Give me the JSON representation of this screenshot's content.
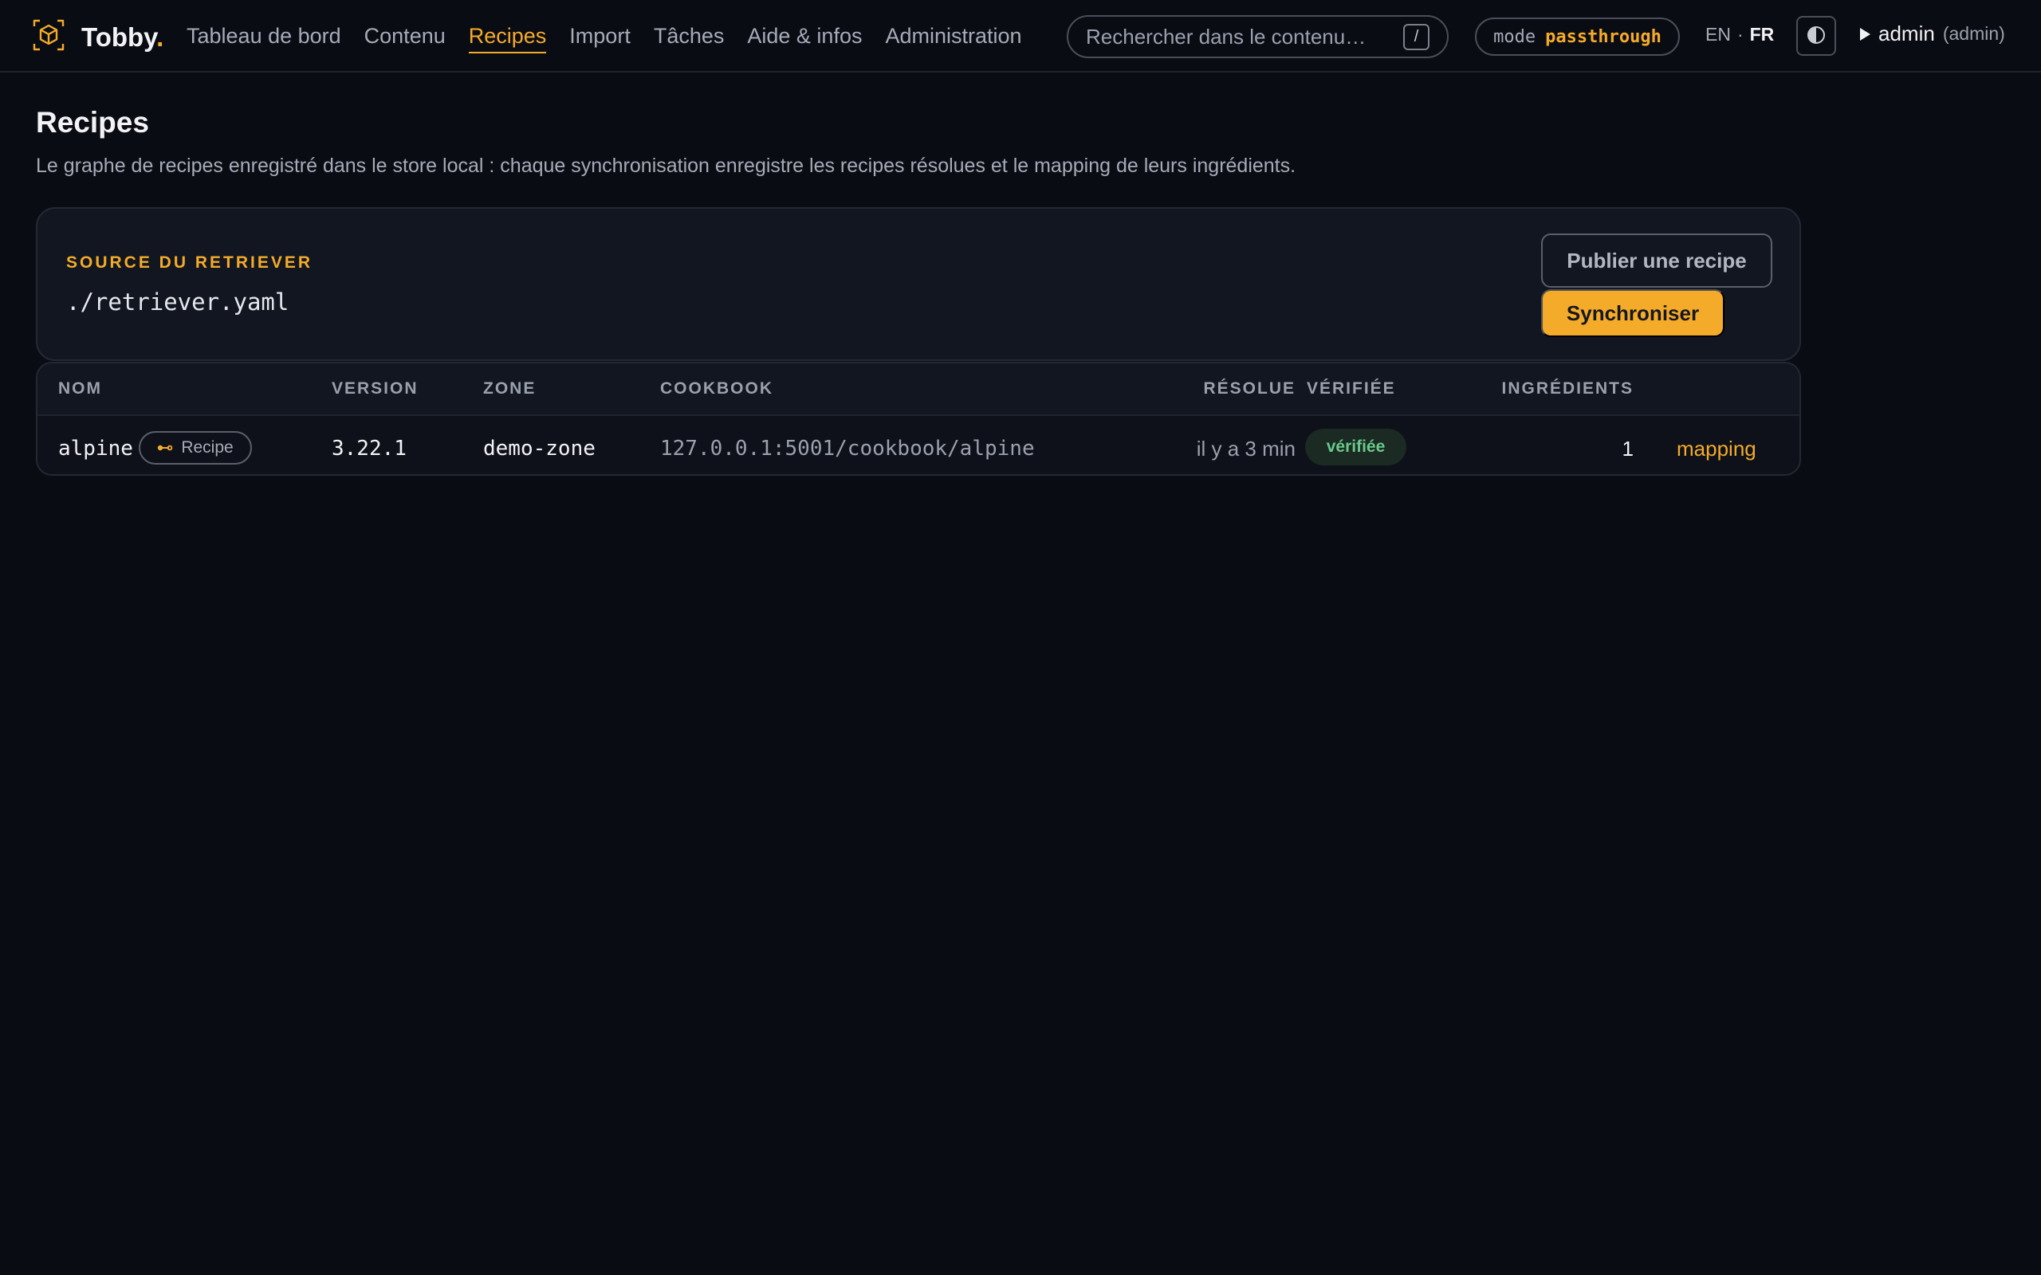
{
  "app": {
    "brand": "Tobby",
    "brand_dot": "."
  },
  "nav": {
    "items": [
      {
        "label": "Tableau de bord"
      },
      {
        "label": "Contenu"
      },
      {
        "label": "Recipes",
        "active": true
      },
      {
        "label": "Import"
      },
      {
        "label": "Tâches"
      },
      {
        "label": "Aide & infos"
      },
      {
        "label": "Administration"
      }
    ]
  },
  "search": {
    "placeholder": "Rechercher dans le contenu…",
    "shortcut": "/"
  },
  "mode": {
    "label": "mode",
    "value": "passthrough"
  },
  "lang": {
    "en": "EN",
    "sep": "·",
    "fr": "FR",
    "active": "FR"
  },
  "theme": {
    "icon": "contrast-icon"
  },
  "user": {
    "name": "admin",
    "role": "(admin)"
  },
  "page": {
    "title": "Recipes",
    "description": "Le graphe de recipes enregistré dans le store local : chaque synchronisation enregistre les recipes résolues et le mapping de leurs ingrédients."
  },
  "source": {
    "label": "SOURCE DU RETRIEVER",
    "path": "./retriever.yaml",
    "publish_label": "Publier une recipe",
    "sync_label": "Synchroniser"
  },
  "table": {
    "headers": {
      "name": "NOM",
      "version": "VERSION",
      "zone": "ZONE",
      "cookbook": "COOKBOOK",
      "resolved": "RÉSOLUE",
      "verified": "VÉRIFIÉE",
      "ingredients": "INGRÉDIENTS"
    },
    "rows": [
      {
        "name": "alpine",
        "badge": "Recipe",
        "version": "3.22.1",
        "zone": "demo-zone",
        "cookbook": "127.0.0.1:5001/cookbook/alpine",
        "resolved": "il y a 3 min",
        "verified": "vérifiée",
        "ingredients": "1",
        "action": "mapping"
      }
    ]
  },
  "colors": {
    "accent": "#f5ab2a",
    "background": "#0a0c13",
    "verified_text": "#69c98a",
    "verified_bg": "#1b2a22"
  }
}
